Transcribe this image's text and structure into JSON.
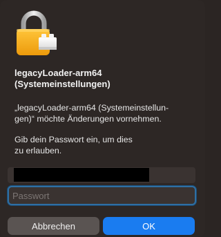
{
  "dialog": {
    "title_line1": "legacyLoader-arm64",
    "title_line2": "(Systemeinstellungen)",
    "message_line1": "„legacyLoader-arm64 (Systemeinstellun-",
    "message_line2": "gen)“ möchte Änderungen vornehmen.",
    "instruction_line1": "Gib dein Passwort ein, um dies",
    "instruction_line2": "zu erlauben.",
    "password_placeholder": "Passwort",
    "cancel_label": "Abbrechen",
    "ok_label": "OK"
  },
  "icons": {
    "lock": "lock-icon"
  },
  "colors": {
    "background": "#2d2725",
    "accent": "#1a7cf0",
    "focus_ring": "#2f6fa3",
    "lock_body": "#f6a91a",
    "lock_shackle": "#cfcfcf"
  }
}
